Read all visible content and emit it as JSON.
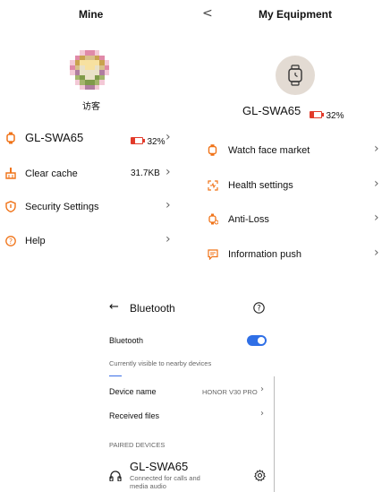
{
  "mine": {
    "title": "Mine",
    "username": "访客",
    "items": [
      {
        "label": "GL-SWA65",
        "battery": "32%",
        "battery_level": 0.32
      },
      {
        "label": "Clear cache",
        "value": "31.7KB"
      },
      {
        "label": "Security Settings"
      },
      {
        "label": "Help"
      }
    ]
  },
  "equipment": {
    "back": "<",
    "title": "My Equipment",
    "device_name": "GL-SWA65",
    "battery": "32%",
    "battery_level": 0.32,
    "items": [
      {
        "label": "Watch face market"
      },
      {
        "label": "Health settings"
      },
      {
        "label": "Anti-Loss"
      },
      {
        "label": "Information push"
      }
    ]
  },
  "bluetooth": {
    "back": "←",
    "title": "Bluetooth",
    "help": "?",
    "toggle_label": "Bluetooth",
    "toggle_on": true,
    "visible_note": "Currently visible to nearby devices",
    "device_name_label": "Device name",
    "device_name_value": "HONOR V30 PRO",
    "received_files_label": "Received files",
    "paired_header": "PAIRED DEVICES",
    "paired_device": {
      "name": "GL-SWA65",
      "subtitle": "Connected for calls and media audio"
    }
  },
  "colors": {
    "accent_orange": "#f07318",
    "battery_red": "#e23a2a",
    "toggle_blue": "#2f6fe6"
  },
  "icons": {
    "watch": "watch-icon",
    "broom": "clear-cache-icon",
    "shield": "shield-icon",
    "help": "help-icon",
    "watchface": "watch-face-icon",
    "health": "health-scan-icon",
    "antiloss": "anti-loss-icon",
    "message": "message-icon",
    "headphones": "headphones-icon",
    "gear": "gear-icon"
  }
}
